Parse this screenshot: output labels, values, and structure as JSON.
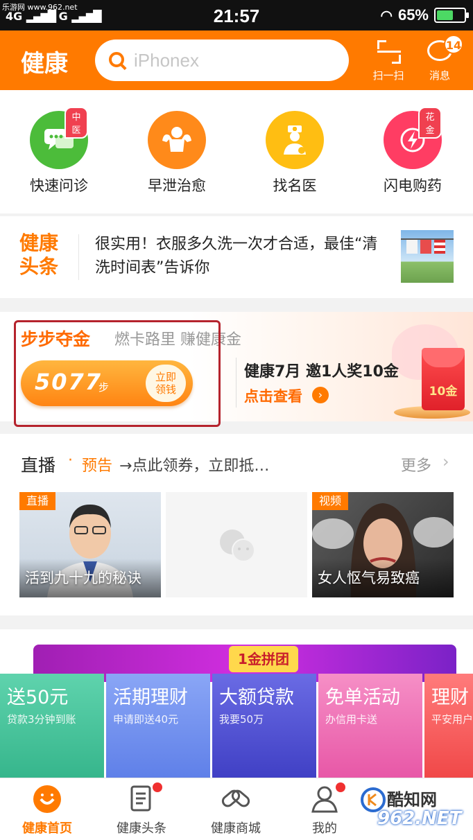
{
  "status_bar": {
    "watermark": "乐游网 www.962.net",
    "network": "4G",
    "network2": "G",
    "time": "21:57",
    "battery": "65%",
    "battery_level": 0.65
  },
  "header": {
    "brand": "健康",
    "search_placeholder": "iPhonex",
    "scan_label": "扫一扫",
    "message_label": "消息",
    "message_badge": "14"
  },
  "quick_entries": [
    {
      "label": "快速问诊",
      "tag": "中医",
      "color": "#4cbc3a",
      "icon": "chat-bubbles-icon"
    },
    {
      "label": "早泄治愈",
      "tag": "",
      "color": "#ff8a1a",
      "icon": "muscle-icon"
    },
    {
      "label": "找名医",
      "tag": "",
      "color": "#ffbe12",
      "icon": "doctor-icon"
    },
    {
      "label": "闪电购药",
      "tag": "花金",
      "color": "#ff3d63",
      "icon": "lightning-icon"
    }
  ],
  "news": {
    "logo_line1": "健康",
    "logo_line2": "头条",
    "headline": "很实用！衣服多久洗一次才合适，最佳“清洗时间表”告诉你"
  },
  "steps": {
    "title": "步步夺金",
    "subtitle": "燃卡路里 赚健康金",
    "count": "5077",
    "unit": "步",
    "claim_line1": "立即",
    "claim_line2": "领钱",
    "promo_title": "健康7月 邀1人奖10金",
    "promo_link": "点击查看",
    "redpack_text": "10金"
  },
  "live": {
    "title": "直播",
    "dot": "·",
    "notice": "预告",
    "description": "→点此领券，立即抵…",
    "more": "更多",
    "cards": [
      {
        "tag": "直播",
        "caption": "活到九十九的秘诀"
      },
      {
        "tag": "",
        "caption": ""
      },
      {
        "tag": "视频",
        "caption": "女人怄气易致癌"
      }
    ]
  },
  "banner": {
    "pill": "1金拼团",
    "tiles": [
      {
        "title": "送50元",
        "sub": "贷款3分钟到账",
        "color": "#3ec49a"
      },
      {
        "title": "活期理财",
        "sub": "申请即送40元",
        "color": "#6f8ef0"
      },
      {
        "title": "大额贷款",
        "sub": "我要50万",
        "color": "#4e4fd6"
      },
      {
        "title": "免单活动",
        "sub": "办信用卡送",
        "color": "#f06ab2"
      },
      {
        "title": "理财",
        "sub": "平安用户",
        "color": "#ff5a5a"
      }
    ]
  },
  "tabbar": [
    {
      "label": "健康首页",
      "active": true
    },
    {
      "label": "健康头条",
      "active": false,
      "dot": true
    },
    {
      "label": "健康商城",
      "active": false
    },
    {
      "label": "我的",
      "active": false,
      "dot": true
    }
  ],
  "watermark": {
    "line1": "酷知网",
    "line2": "962.NET"
  }
}
